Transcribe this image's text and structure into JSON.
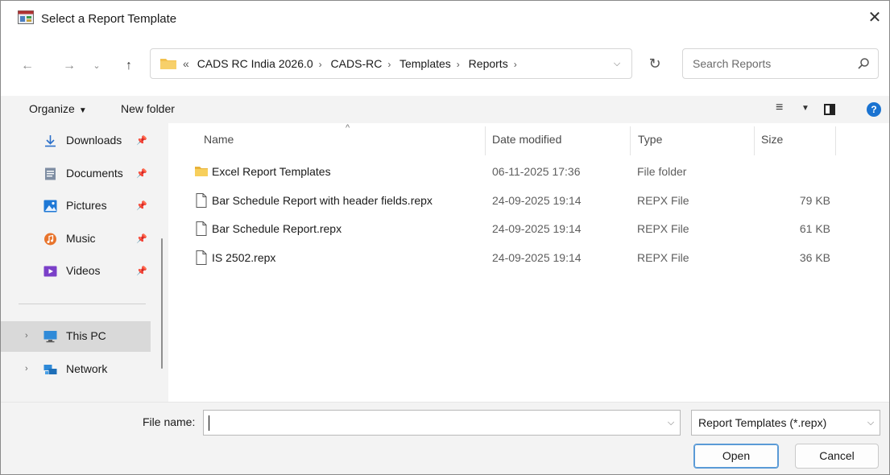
{
  "window": {
    "title": "Select a Report Template",
    "close_label": "✕"
  },
  "nav": {
    "back_label": "←",
    "forward_label": "→",
    "recent_label": "⌄",
    "up_label": "↑",
    "breadcrumb_prefix": "«",
    "breadcrumbs": [
      "CADS RC India 2026.0",
      "CADS-RC",
      "Templates",
      "Reports"
    ],
    "refresh_label": "↻",
    "search_placeholder": "Search Reports"
  },
  "commands": {
    "organize": "Organize",
    "new_folder": "New folder"
  },
  "sidebar": {
    "items": [
      {
        "label": "Downloads",
        "icon": "download-icon",
        "pinned": true
      },
      {
        "label": "Documents",
        "icon": "documents-icon",
        "pinned": true
      },
      {
        "label": "Pictures",
        "icon": "pictures-icon",
        "pinned": true
      },
      {
        "label": "Music",
        "icon": "music-icon",
        "pinned": true
      },
      {
        "label": "Videos",
        "icon": "videos-icon",
        "pinned": true
      },
      {
        "label": "This PC",
        "icon": "pc-icon",
        "selected": true
      },
      {
        "label": "Network",
        "icon": "network-icon"
      }
    ]
  },
  "columns": {
    "name": "Name",
    "date": "Date modified",
    "type": "Type",
    "size": "Size"
  },
  "files": [
    {
      "name": "Excel Report Templates",
      "date": "06-11-2025 17:36",
      "type": "File folder",
      "size": "",
      "icon": "folder-icon"
    },
    {
      "name": "Bar Schedule Report with header fields.repx",
      "date": "24-09-2025 19:14",
      "type": "REPX File",
      "size": "79 KB",
      "icon": "file-icon"
    },
    {
      "name": "Bar Schedule Report.repx",
      "date": "24-09-2025 19:14",
      "type": "REPX File",
      "size": "61 KB",
      "icon": "file-icon"
    },
    {
      "name": "IS 2502.repx",
      "date": "24-09-2025 19:14",
      "type": "REPX File",
      "size": "36 KB",
      "icon": "file-icon"
    }
  ],
  "footer": {
    "file_name_label": "File name:",
    "file_name_value": "",
    "filter": "Report Templates (*.repx)",
    "open_label": "Open",
    "cancel_label": "Cancel"
  },
  "colors": {
    "accent": "#1a73d1",
    "folder": "#f2c14e",
    "pane": "#f3f3f3",
    "selected": "#d9d9d9"
  }
}
